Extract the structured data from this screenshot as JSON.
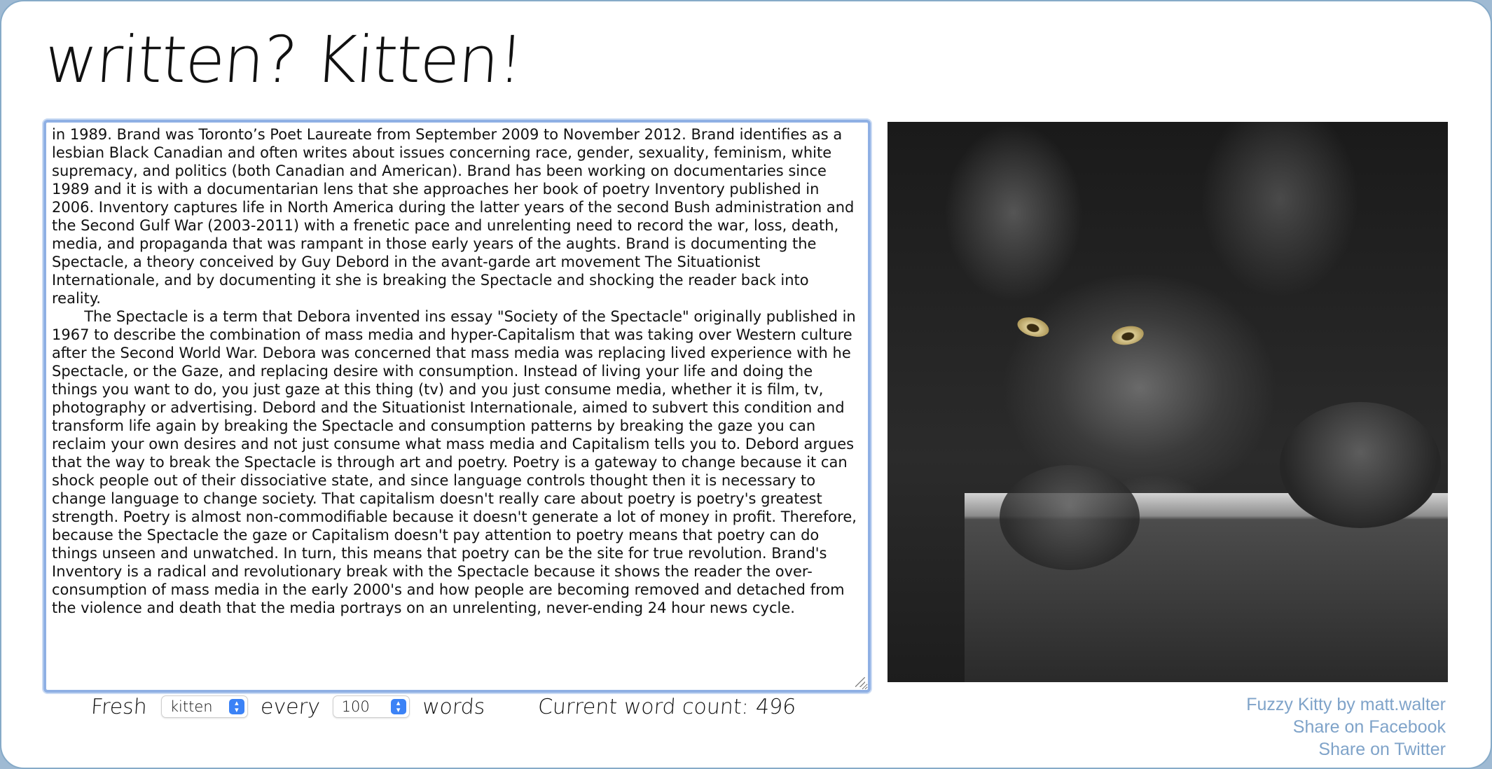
{
  "title": "written? Kitten!",
  "editor": {
    "paragraphs": [
      "in 1989. Brand was Toronto’s Poet Laureate from September 2009 to November 2012. Brand identifies as a lesbian Black Canadian and often writes about issues concerning race, gender, sexuality, feminism, white supremacy, and politics (both Canadian and American). Brand has been working on documentaries since 1989 and it is with a documentarian lens that she approaches her book of poetry Inventory published in 2006. Inventory captures life in North America during the latter years of the second Bush administration and the Second Gulf War (2003-2011) with a frenetic pace and unrelenting need to record the war, loss, death, media, and propaganda that was rampant in those early years of the aughts. Brand is documenting the Spectacle, a theory conceived by Guy Debord in the avant-garde art movement The Situationist Internationale, and by documenting it she is breaking the Spectacle and shocking the reader back into reality.",
      "The Spectacle is a term that Debora invented ins essay \"Society of the Spectacle\" originally published in 1967 to describe the combination of mass media and hyper-Capitalism that was taking over Western culture after the Second World War. Debora was concerned that mass media was replacing lived experience with he Spectacle, or the Gaze, and replacing desire with consumption. Instead of living your life and doing the things you want to do, you just gaze at this thing (tv) and you just consume media, whether it is film, tv, photography or advertising. Debord and the Situationist Internationale, aimed to subvert this condition and transform life again by breaking the Spectacle and consumption patterns by breaking the gaze you can reclaim your own desires and not just consume what mass media and Capitalism tells you to. Debord argues that the way to break the Spectacle is through art and poetry. Poetry is a gateway to change because it can shock people out of their dissociative state, and since language controls thought then it is necessary to change language to change society. That capitalism doesn't really care about poetry is poetry's greatest strength. Poetry is almost non-commodifiable because it doesn't generate a lot of money in profit. Therefore, because the Spectacle the gaze or Capitalism doesn't pay attention to poetry means that poetry can do things unseen and unwatched. In turn, this means that poetry can be the site for true revolution. Brand's Inventory is a radical and revolutionary break with the Spectacle because it shows the reader the over-consumption of mass media in the early 2000's and how people are becoming removed and detached from the violence and death that the media portrays on an unrelenting, never-ending 24 hour news cycle."
    ]
  },
  "photo": {
    "subject": "black fluffy cat on a shelf"
  },
  "controls": {
    "fresh_label": "Fresh",
    "animal_value": "kitten",
    "every_label": "every",
    "interval_value": "100",
    "words_label": "words",
    "count_label": "Current word count:",
    "count_value": "496"
  },
  "links": {
    "credit": "Fuzzy Kitty by matt.walter",
    "facebook": "Share on Facebook",
    "twitter": "Share on Twitter"
  },
  "colors": {
    "accent": "#3b82f6",
    "link": "#7fa3c9",
    "focus_ring": "#8fb0e4",
    "frame_background": "#9fbad3"
  }
}
